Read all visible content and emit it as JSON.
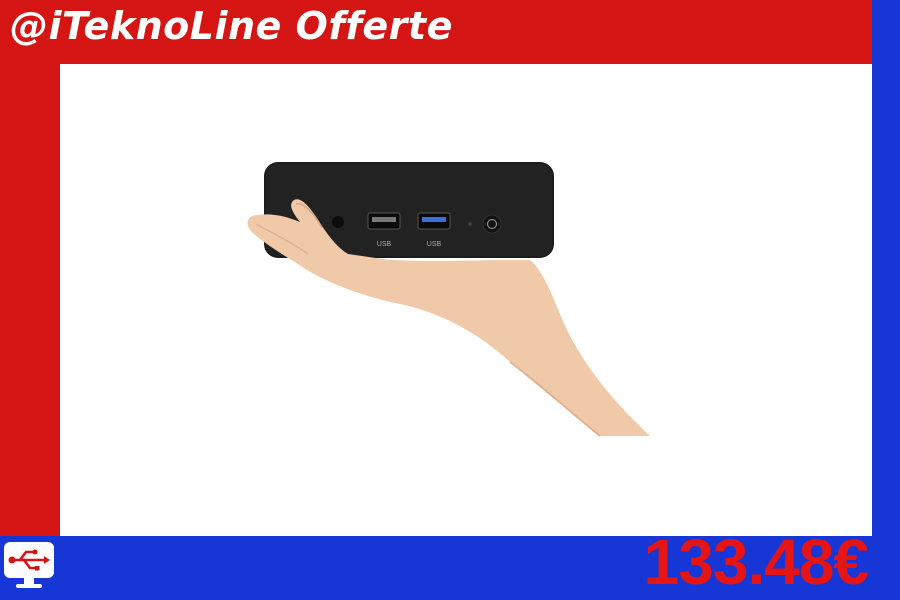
{
  "header": {
    "title": "@iTeknoLine Offerte"
  },
  "product": {
    "port_label_1": "USB",
    "port_label_2": "USB",
    "image_icon": "mini-pc-in-hand"
  },
  "footer": {
    "price": "133.48€",
    "logo_icon": "usb-monitor-icon"
  },
  "colors": {
    "red": "#d51414",
    "blue": "#1736d6",
    "price": "#e51515",
    "white": "#ffffff"
  }
}
